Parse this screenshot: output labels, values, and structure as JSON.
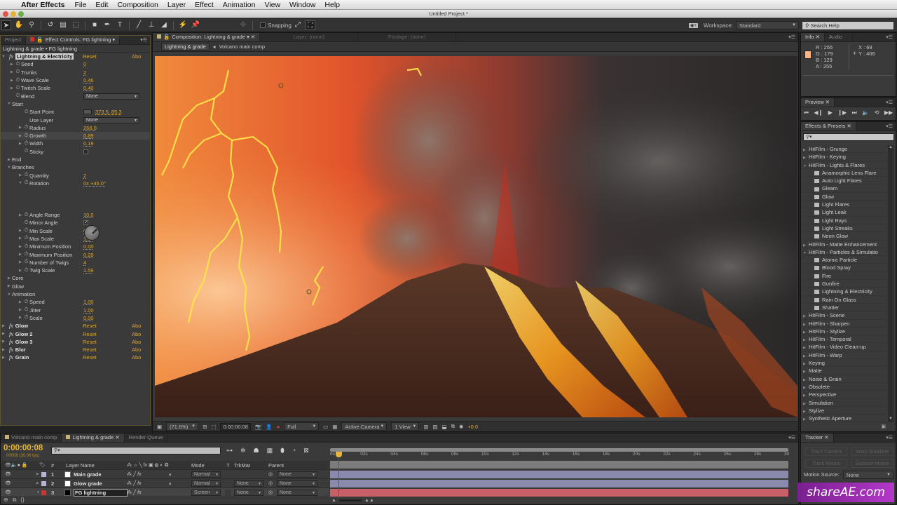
{
  "menubar": {
    "app": "After Effects",
    "items": [
      "File",
      "Edit",
      "Composition",
      "Layer",
      "Effect",
      "Animation",
      "View",
      "Window",
      "Help"
    ]
  },
  "window_title": "Untitled Project *",
  "toolbar": {
    "snapping_label": "Snapping",
    "workspace_label": "Workspace:",
    "workspace_value": "Standard",
    "search_help_placeholder": "Search Help"
  },
  "effect_controls": {
    "tabs": [
      "Project",
      "Effect Controls: FG lightning"
    ],
    "breadcrumb": "Lightning & grade • FG lightning",
    "reset_label": "Reset",
    "about_label": "Abo",
    "rows": [
      {
        "type": "fx",
        "label": "Lightning & Electricity",
        "open": true
      },
      {
        "label": "Seed",
        "value": "0",
        "indent": 1
      },
      {
        "label": "Trunks",
        "value": "2",
        "indent": 1
      },
      {
        "label": "Wave Scale",
        "value": "0.46",
        "indent": 1
      },
      {
        "label": "Twitch Scale",
        "value": "0.40",
        "indent": 1
      },
      {
        "label": "Blend",
        "dropdown": "None",
        "indent": 1,
        "nochild": true
      },
      {
        "type": "group",
        "label": "Start",
        "open": true
      },
      {
        "label": "Start Point",
        "value": "373.5, 85.3",
        "indent": 2,
        "nochild": true,
        "point": true
      },
      {
        "label": "Use Layer",
        "dropdown": "None",
        "indent": 2,
        "nochild": true,
        "nostop": true
      },
      {
        "label": "Radius",
        "value": "266.0",
        "indent": 2
      },
      {
        "label": "Growth",
        "value": "0.89",
        "indent": 2,
        "hl": true
      },
      {
        "label": "Width",
        "value": "0.19",
        "indent": 2
      },
      {
        "label": "Sticky",
        "checkbox": false,
        "indent": 2,
        "nochild": true
      },
      {
        "type": "group",
        "label": "End",
        "open": false
      },
      {
        "type": "group",
        "label": "Branches",
        "open": true
      },
      {
        "label": "Quantity",
        "value": "2",
        "indent": 2
      },
      {
        "label": "Rotation",
        "value": "0x +45.0°",
        "indent": 2,
        "open": true
      },
      {
        "type": "spacer"
      },
      {
        "type": "spacer"
      },
      {
        "type": "spacer"
      },
      {
        "label": "Angle Range",
        "value": "10.0",
        "indent": 2
      },
      {
        "label": "Mirror Angle",
        "checkbox": true,
        "indent": 2,
        "nochild": true
      },
      {
        "label": "Min Scale",
        "value": "0.00",
        "indent": 2
      },
      {
        "label": "Max Scale",
        "value": "1.00",
        "indent": 2
      },
      {
        "label": "Minimum Position",
        "value": "0.00",
        "indent": 2
      },
      {
        "label": "Maximum Position",
        "value": "0.28",
        "indent": 2
      },
      {
        "label": "Number of Twigs",
        "value": "4",
        "indent": 2
      },
      {
        "label": "Twig Scale",
        "value": "1.59",
        "indent": 2
      },
      {
        "type": "group",
        "label": "Core",
        "open": false
      },
      {
        "type": "group",
        "label": "Glow",
        "open": false
      },
      {
        "type": "group",
        "label": "Animation",
        "open": true
      },
      {
        "label": "Speed",
        "value": "1.00",
        "indent": 2
      },
      {
        "label": "Jitter",
        "value": "1.00",
        "indent": 2
      },
      {
        "label": "Scale",
        "value": "0.00",
        "indent": 2
      },
      {
        "type": "fx",
        "label": "Glow",
        "open": false
      },
      {
        "type": "fx",
        "label": "Glow 2",
        "open": false
      },
      {
        "type": "fx",
        "label": "Glow 3",
        "open": false
      },
      {
        "type": "fx",
        "label": "Blur",
        "open": false
      },
      {
        "type": "fx",
        "label": "Grain",
        "open": false
      }
    ]
  },
  "composition": {
    "tabs": [
      "Composition: Lightning & grade",
      "Layer: (none)",
      "Footage: (none)"
    ],
    "breadcrumb": [
      "Lightning & grade",
      "Volcano main comp"
    ],
    "zoom": "(71.6%)",
    "timecode": "0:00:00:08",
    "resolution": "Full",
    "camera": "Active Camera",
    "views": "1 View",
    "exposure": "+0.0"
  },
  "info": {
    "tabs": [
      "Info",
      "Audio"
    ],
    "R": "R : 255",
    "G": "G : 179",
    "B": "B : 129",
    "A": "A : 255",
    "X": "X : 69",
    "Y": "Y : 406",
    "swatch": "#ffb381"
  },
  "preview": {
    "tab": "Preview"
  },
  "effects_presets": {
    "tab": "Effects & Presets",
    "items": [
      {
        "label": "HitFilm - Grunge",
        "kind": "folder"
      },
      {
        "label": "HitFilm - Keying",
        "kind": "folder"
      },
      {
        "label": "HitFilm - Lights & Flares",
        "kind": "folder-open"
      },
      {
        "label": "Anamorphic Lens Flare",
        "kind": "effect"
      },
      {
        "label": "Auto Light Flares",
        "kind": "effect"
      },
      {
        "label": "Gleam",
        "kind": "effect"
      },
      {
        "label": "Glow",
        "kind": "effect"
      },
      {
        "label": "Light Flares",
        "kind": "effect"
      },
      {
        "label": "Light Leak",
        "kind": "effect"
      },
      {
        "label": "Light Rays",
        "kind": "effect"
      },
      {
        "label": "Light Streaks",
        "kind": "effect"
      },
      {
        "label": "Neon Glow",
        "kind": "effect"
      },
      {
        "label": "HitFilm - Matte Enhancement",
        "kind": "folder"
      },
      {
        "label": "HitFilm - Particles & Simulatio",
        "kind": "folder-open"
      },
      {
        "label": "Atomic Particle",
        "kind": "effect"
      },
      {
        "label": "Blood Spray",
        "kind": "effect"
      },
      {
        "label": "Fire",
        "kind": "effect"
      },
      {
        "label": "Gunfire",
        "kind": "effect"
      },
      {
        "label": "Lightning & Electricity",
        "kind": "effect"
      },
      {
        "label": "Rain On Glass",
        "kind": "effect"
      },
      {
        "label": "Shatter",
        "kind": "effect"
      },
      {
        "label": "HitFilm - Scene",
        "kind": "folder"
      },
      {
        "label": "HitFilm - Sharpen",
        "kind": "folder"
      },
      {
        "label": "HitFilm - Stylize",
        "kind": "folder"
      },
      {
        "label": "HitFilm - Temporal",
        "kind": "folder"
      },
      {
        "label": "HitFilm - Video Clean-up",
        "kind": "folder"
      },
      {
        "label": "HitFilm - Warp",
        "kind": "folder"
      },
      {
        "label": "Keying",
        "kind": "folder"
      },
      {
        "label": "Matte",
        "kind": "folder"
      },
      {
        "label": "Noise & Grain",
        "kind": "folder"
      },
      {
        "label": "Obsolete",
        "kind": "folder"
      },
      {
        "label": "Perspective",
        "kind": "folder"
      },
      {
        "label": "Simulation",
        "kind": "folder"
      },
      {
        "label": "Stylize",
        "kind": "folder"
      },
      {
        "label": "Synthetic Aperture",
        "kind": "folder"
      }
    ]
  },
  "tracker": {
    "tab": "Tracker",
    "buttons": [
      "Track Camera",
      "Warp Stabilizer",
      "Track Motion",
      "Stabilize Motion"
    ],
    "motion_source_label": "Motion Source:",
    "motion_source_value": "None"
  },
  "timeline": {
    "tabs": [
      "Volcano main comp",
      "Lightning & grade",
      "Render Queue"
    ],
    "timecode": "0:00:00:08",
    "frame_info": "00008 (30.00 fps)",
    "headers": {
      "num": "#",
      "layer_name": "Layer Name",
      "mode": "Mode",
      "t": "T",
      "trkmat": "TrkMat",
      "parent": "Parent"
    },
    "layers": [
      {
        "num": "1",
        "name": "Main grade",
        "mode": "Normal",
        "trkmat": "",
        "parent": "None",
        "label_color": "#b4b4d8",
        "swatch": "#ffffff",
        "track_color": "#8a8aac"
      },
      {
        "num": "2",
        "name": "Glow grade",
        "mode": "Normal",
        "trkmat": "None",
        "parent": "None",
        "label_color": "#b4b4d8",
        "swatch": "#ffffff",
        "track_color": "#8a8aac"
      },
      {
        "num": "3",
        "name": "FG lightning",
        "mode": "Screen",
        "trkmat": "None",
        "parent": "None",
        "label_color": "#d03030",
        "swatch": "#000000",
        "track_color": "#c8606a"
      }
    ],
    "ruler": [
      "0s",
      "02s",
      "04s",
      "06s",
      "08s",
      "10s",
      "12s",
      "14s",
      "16s",
      "18s",
      "20s",
      "22s",
      "24s",
      "26s",
      "28s",
      "30"
    ],
    "playhead_fraction": 0.009
  },
  "watermark": "shareAE.com"
}
